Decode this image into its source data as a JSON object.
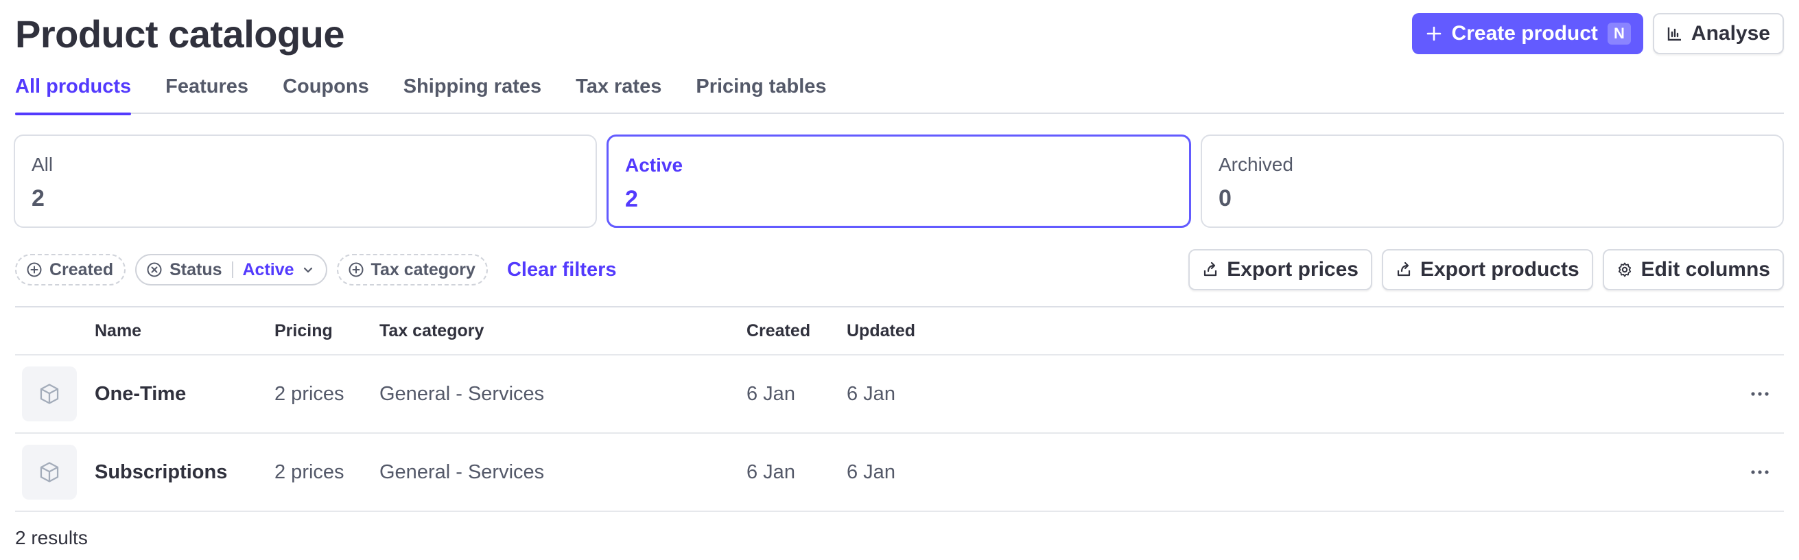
{
  "header": {
    "title": "Product catalogue",
    "create_label": "Create product",
    "create_shortcut": "N",
    "analyse_label": "Analyse"
  },
  "tabs": [
    {
      "label": "All products",
      "active": true
    },
    {
      "label": "Features"
    },
    {
      "label": "Coupons"
    },
    {
      "label": "Shipping rates"
    },
    {
      "label": "Tax rates"
    },
    {
      "label": "Pricing tables"
    }
  ],
  "cards": [
    {
      "label": "All",
      "count": "2"
    },
    {
      "label": "Active",
      "count": "2",
      "active": true
    },
    {
      "label": "Archived",
      "count": "0"
    }
  ],
  "filters": {
    "created": "Created",
    "status": "Status",
    "status_value": "Active",
    "tax_category": "Tax category",
    "clear": "Clear filters"
  },
  "actions": {
    "export_prices": "Export prices",
    "export_products": "Export products",
    "edit_columns": "Edit columns"
  },
  "table": {
    "columns": [
      "Name",
      "Pricing",
      "Tax category",
      "Created",
      "Updated"
    ],
    "rows": [
      {
        "name": "One-Time",
        "pricing": "2 prices",
        "tax": "General - Services",
        "created": "6 Jan",
        "updated": "6 Jan"
      },
      {
        "name": "Subscriptions",
        "pricing": "2 prices",
        "tax": "General - Services",
        "created": "6 Jan",
        "updated": "6 Jan"
      }
    ]
  },
  "results": "2 results",
  "icons": {
    "plus": "plus-icon",
    "chart": "bar-chart-icon",
    "circle_plus": "circle-plus-icon",
    "circle_x": "circle-x-icon",
    "chevron": "chevron-down-icon",
    "export": "export-icon",
    "gear": "gear-icon",
    "box": "box-icon",
    "more": "more-icon"
  },
  "colors": {
    "accent": "#635bff",
    "accent_text": "#533afd",
    "text": "#30313d",
    "muted": "#545969",
    "border": "#dcdfe6"
  }
}
